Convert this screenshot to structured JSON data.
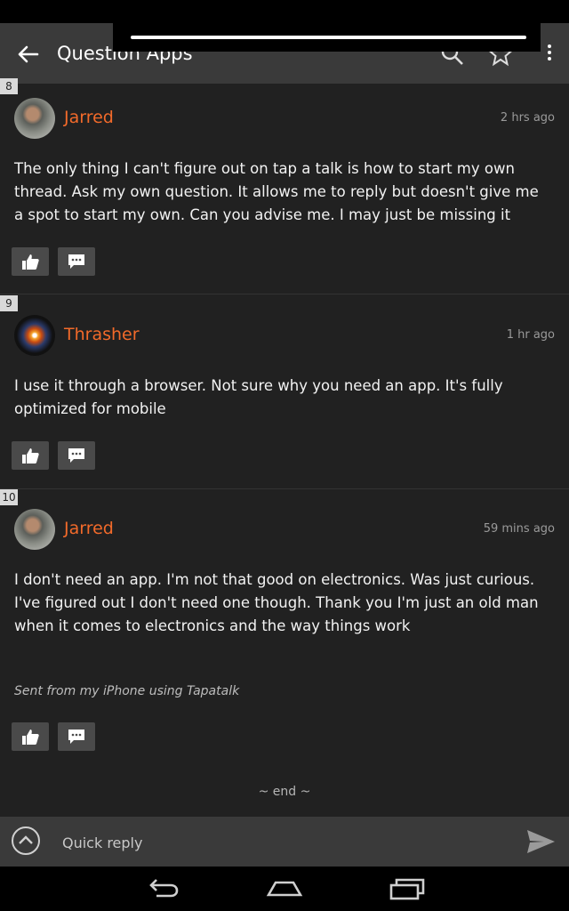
{
  "app_bar": {
    "title": "Question Apps",
    "icons": [
      "back-arrow-icon",
      "search-icon",
      "star-icon",
      "overflow-menu-icon"
    ]
  },
  "posts": [
    {
      "number": "8",
      "author": "Jarred",
      "avatar": "jarred-avatar",
      "time": "2 hrs ago",
      "body": "The only thing I can't figure out on tap a talk is how to start my own thread. Ask my own question. It allows me to reply but doesn't give me a spot to start my own. Can you advise me. I may just be missing it"
    },
    {
      "number": "9",
      "author": "Thrasher",
      "avatar": "thrasher-avatar",
      "time": "1 hr ago",
      "body": "I use it through a browser. Not sure why you need an app. It's fully optimized for mobile"
    },
    {
      "number": "10",
      "author": "Jarred",
      "avatar": "jarred-avatar",
      "time": "59 mins ago",
      "body": "I don't need an app. I'm not that good on electronics. Was just curious. I've figured out I don't need one though. Thank you I'm just an old man when it comes to electronics and the way things work",
      "signature": "Sent from my iPhone using Tapatalk"
    }
  ],
  "end_label": "~ end ~",
  "quick_reply": {
    "placeholder": "Quick reply"
  },
  "colors": {
    "accent": "#f26a2a",
    "background": "#212121",
    "bar": "#3a3a3a"
  }
}
